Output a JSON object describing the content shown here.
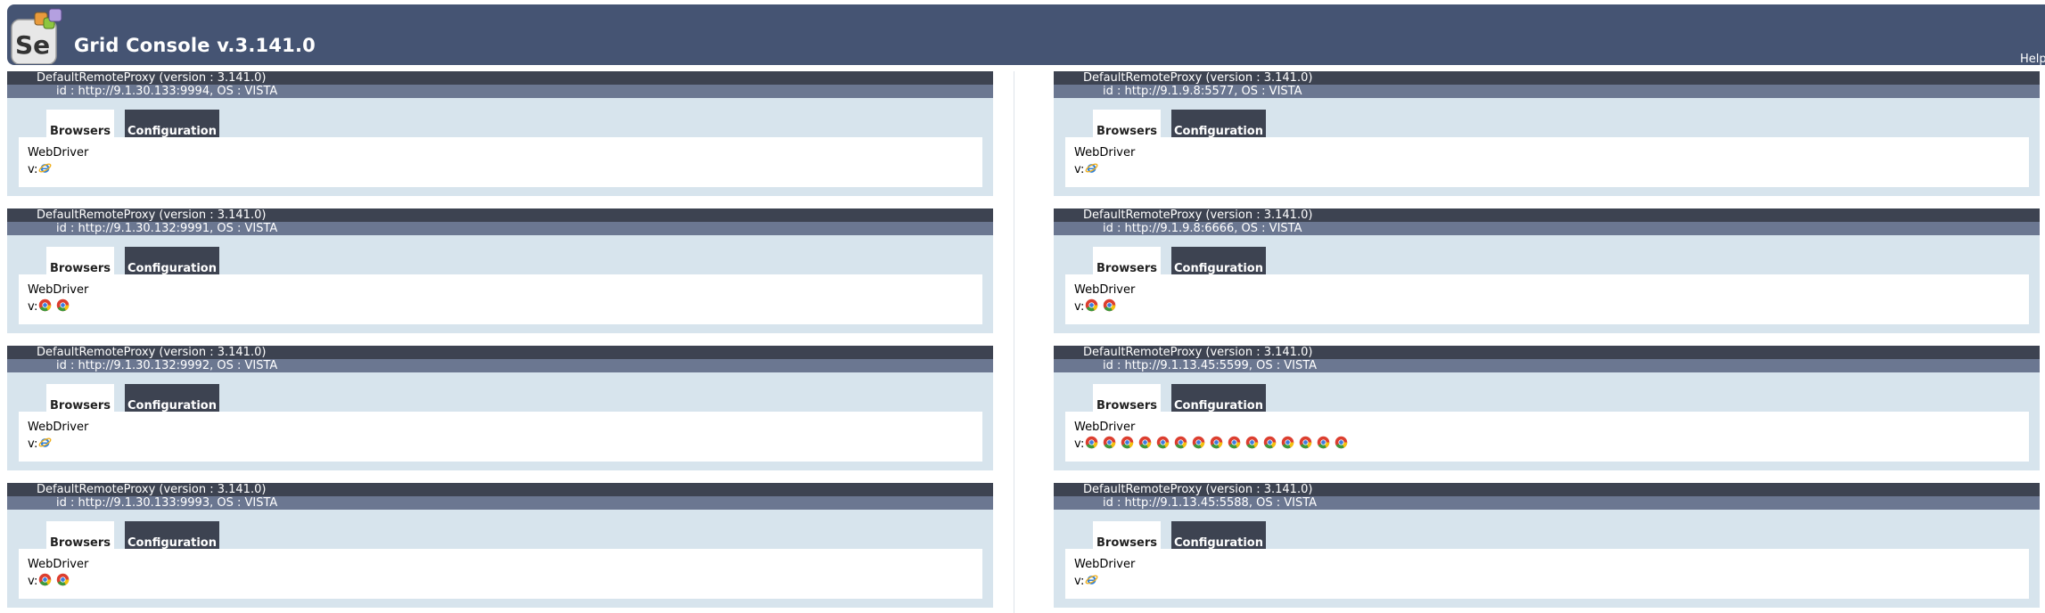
{
  "header": {
    "title": "Grid Console v.3.141.0",
    "help_label": "Help",
    "logo_text": "Se",
    "background": "#455473"
  },
  "tabs": {
    "browsers": "Browsers",
    "configuration": "Configuration"
  },
  "webdriver_label": "WebDriver",
  "version_prefix": "v:",
  "colors": {
    "header_dark": "#3d4351",
    "header_light": "#6b7791",
    "panel_bg": "#d7e4ed",
    "page_bg": "#ffffff"
  },
  "proxies": [
    {
      "title": "DefaultRemoteProxy (version : 3.141.0)",
      "id_line": "id : http://9.1.30.133:9994, OS : VISTA",
      "browsers": [
        "internet-explorer-icon"
      ]
    },
    {
      "title": "DefaultRemoteProxy (version : 3.141.0)",
      "id_line": "id : http://9.1.9.8:5577, OS : VISTA",
      "browsers": [
        "internet-explorer-icon"
      ]
    },
    {
      "title": "DefaultRemoteProxy (version : 3.141.0)",
      "id_line": "id : http://9.1.30.132:9991, OS : VISTA",
      "browsers": [
        "chrome-icon",
        "chrome-icon"
      ]
    },
    {
      "title": "DefaultRemoteProxy (version : 3.141.0)",
      "id_line": "id : http://9.1.9.8:6666, OS : VISTA",
      "browsers": [
        "chrome-icon",
        "chrome-icon"
      ]
    },
    {
      "title": "DefaultRemoteProxy (version : 3.141.0)",
      "id_line": "id : http://9.1.30.132:9992, OS : VISTA",
      "browsers": [
        "internet-explorer-icon"
      ]
    },
    {
      "title": "DefaultRemoteProxy (version : 3.141.0)",
      "id_line": "id : http://9.1.13.45:5599, OS : VISTA",
      "browsers": [
        "chrome-icon",
        "chrome-icon",
        "chrome-icon",
        "chrome-icon",
        "chrome-icon",
        "chrome-icon",
        "chrome-icon",
        "chrome-icon",
        "chrome-icon",
        "chrome-icon",
        "chrome-icon",
        "chrome-icon",
        "chrome-icon",
        "chrome-icon",
        "chrome-icon"
      ]
    },
    {
      "title": "DefaultRemoteProxy (version : 3.141.0)",
      "id_line": "id : http://9.1.30.133:9993, OS : VISTA",
      "browsers": [
        "chrome-icon",
        "chrome-icon"
      ]
    },
    {
      "title": "DefaultRemoteProxy (version : 3.141.0)",
      "id_line": "id : http://9.1.13.45:5588, OS : VISTA",
      "browsers": [
        "internet-explorer-icon"
      ]
    }
  ]
}
